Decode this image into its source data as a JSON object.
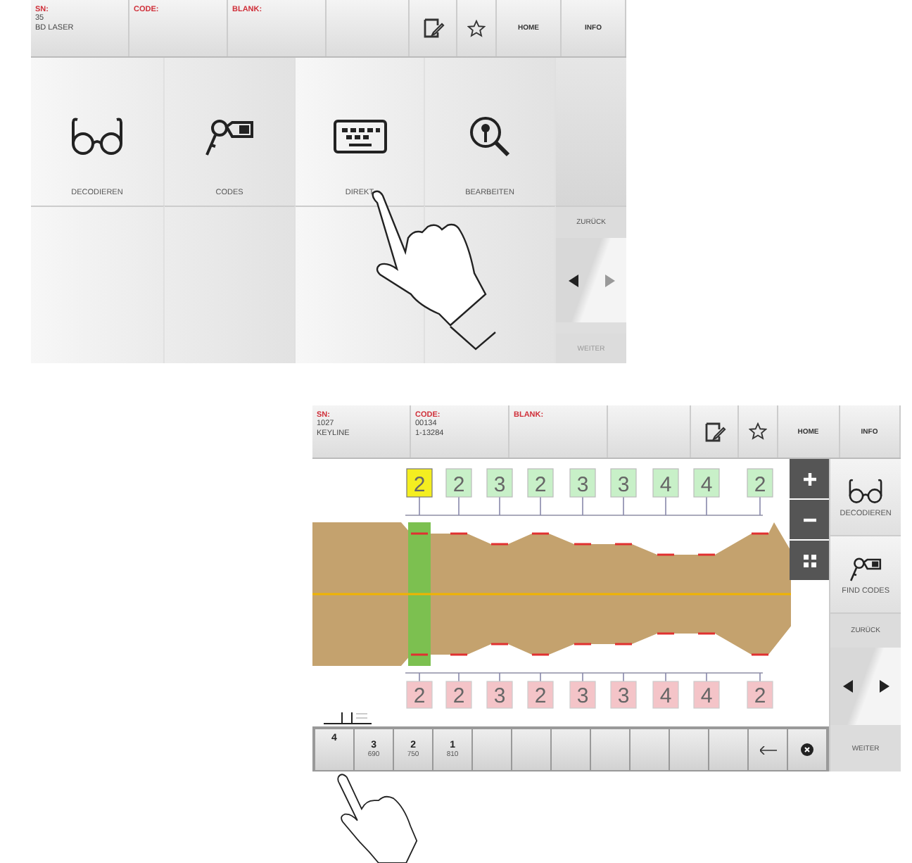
{
  "screen_1": {
    "info": [
      {
        "label": "SN:",
        "lines": [
          "35",
          "BD LASER"
        ]
      },
      {
        "label": "CODE:"
      },
      {
        "label": "BLANK:"
      }
    ],
    "header_buttons": [
      "HOME",
      "INFO"
    ],
    "tiles": [
      {
        "kind": "glasses",
        "label": "DECODIEREN"
      },
      {
        "kind": "key-tag",
        "label": "CODES"
      },
      {
        "kind": "keyboard",
        "label": "DIREKT"
      },
      {
        "kind": "magnifier",
        "label": "BEARBEITEN"
      }
    ],
    "nav": {
      "back": "ZURÜCK",
      "next": "WEITER"
    }
  },
  "screen_2": {
    "info": [
      {
        "label": "SN:",
        "lines": [
          "1027",
          "KEYLINE"
        ]
      },
      {
        "label": "CODE:",
        "lines": [
          "00134",
          "1-13284"
        ]
      },
      {
        "label": "BLANK:"
      }
    ],
    "header_buttons": [
      "HOME",
      "INFO"
    ],
    "top_cuts": [
      {
        "value": "2",
        "selected": true
      },
      {
        "value": "2",
        "selected": false
      },
      {
        "value": "3",
        "selected": false
      },
      {
        "value": "2",
        "selected": false
      },
      {
        "value": "3",
        "selected": false
      },
      {
        "value": "3",
        "selected": false
      },
      {
        "value": "4",
        "selected": false
      },
      {
        "value": "4",
        "selected": false
      },
      {
        "value": "2",
        "selected": false
      }
    ],
    "bottom_cuts": [
      "2",
      "2",
      "3",
      "2",
      "3",
      "3",
      "4",
      "4",
      "2"
    ],
    "side_tiles": [
      {
        "kind": "glasses",
        "label": "DECODIEREN"
      },
      {
        "kind": "key-tag",
        "label": "FIND CODES"
      }
    ],
    "keypad": [
      {
        "kind": "digit",
        "label": "4"
      },
      {
        "kind": "digit",
        "label": "3",
        "sub": "690"
      },
      {
        "kind": "digit",
        "label": "2",
        "sub": "750"
      },
      {
        "kind": "digit",
        "label": "1",
        "sub": "810"
      },
      {
        "kind": "blank"
      },
      {
        "kind": "blank"
      },
      {
        "kind": "blank"
      },
      {
        "kind": "blank"
      },
      {
        "kind": "blank"
      },
      {
        "kind": "blank"
      },
      {
        "kind": "blank"
      },
      {
        "kind": "back"
      },
      {
        "kind": "clear"
      }
    ],
    "nav": {
      "back": "ZURÜCK",
      "next": "WEITER"
    }
  }
}
